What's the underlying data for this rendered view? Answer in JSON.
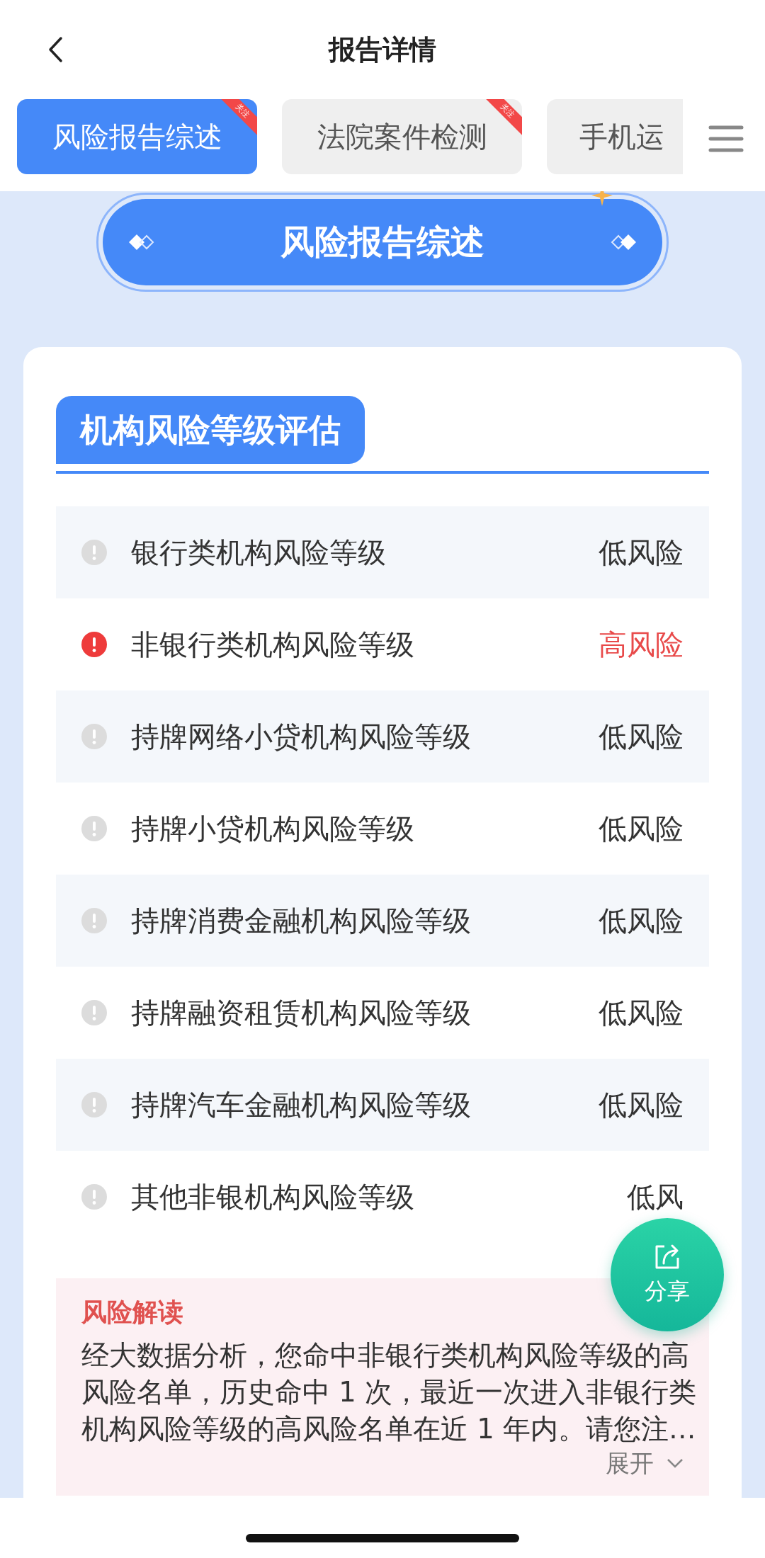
{
  "header": {
    "title": "报告详情"
  },
  "tabs": [
    {
      "label": "风险报告综述",
      "selected": true,
      "ribbon": "关注"
    },
    {
      "label": "法院案件检测",
      "selected": false,
      "ribbon": "关注"
    },
    {
      "label": "手机运",
      "selected": false
    }
  ],
  "banner": {
    "title": "风险报告综述"
  },
  "section": {
    "title": "机构风险等级评估",
    "rows": [
      {
        "label": "银行类机构风险等级",
        "value": "低风险",
        "high_risk": false
      },
      {
        "label": "非银行类机构风险等级",
        "value": "高风险",
        "high_risk": true
      },
      {
        "label": "持牌网络小贷机构风险等级",
        "value": "低风险",
        "high_risk": false
      },
      {
        "label": "持牌小贷机构风险等级",
        "value": "低风险",
        "high_risk": false
      },
      {
        "label": "持牌消费金融机构风险等级",
        "value": "低风险",
        "high_risk": false
      },
      {
        "label": "持牌融资租赁机构风险等级",
        "value": "低风险",
        "high_risk": false
      },
      {
        "label": "持牌汽车金融机构风险等级",
        "value": "低风险",
        "high_risk": false
      },
      {
        "label": "其他非银机构风险等级",
        "value": "低风",
        "high_risk": false
      }
    ]
  },
  "interpretation": {
    "title": "风险解读",
    "text": "经大数据分析，您命中非银行类机构风险等级的高风险名单，历史命中 1 次，最近一次进入非银行类机构风险等级的高风险名单在近 1 年内。请您注…",
    "expand": "展开"
  },
  "share_button": {
    "label": "分享"
  }
}
